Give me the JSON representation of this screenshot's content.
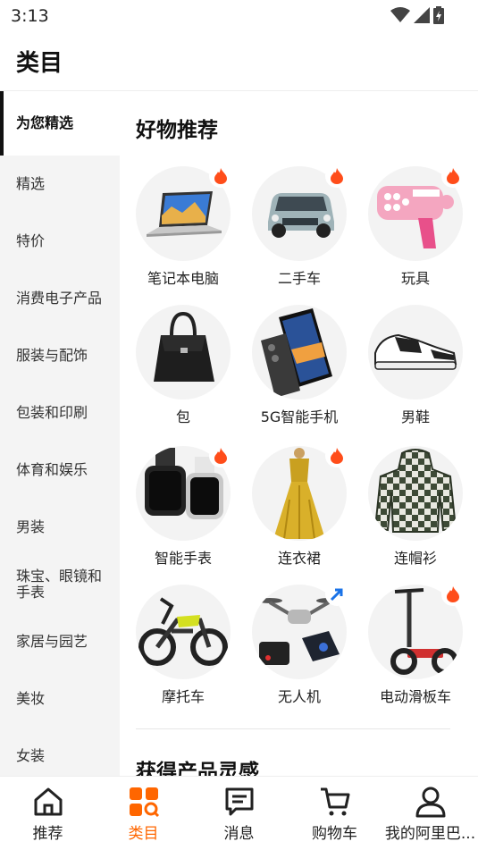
{
  "status": {
    "time": "3:13"
  },
  "header": {
    "title": "类目"
  },
  "sidebar": {
    "items": [
      {
        "label": "为您精选"
      },
      {
        "label": "精选"
      },
      {
        "label": "特价"
      },
      {
        "label": "消费电子产品"
      },
      {
        "label": "服装与配饰"
      },
      {
        "label": "包装和印刷"
      },
      {
        "label": "体育和娱乐"
      },
      {
        "label": "男装"
      },
      {
        "label": "珠宝、眼镜和手表"
      },
      {
        "label": "家居与园艺"
      },
      {
        "label": "美妆"
      },
      {
        "label": "女装"
      }
    ]
  },
  "main": {
    "section_title": "好物推荐",
    "next_section_title": "获得产品灵感",
    "items": [
      {
        "label": "笔记本电脑",
        "badge": "fire",
        "icon": "laptop-icon"
      },
      {
        "label": "二手车",
        "badge": "fire",
        "icon": "car-icon"
      },
      {
        "label": "玩具",
        "badge": "fire",
        "icon": "bubble-gun-icon"
      },
      {
        "label": "包",
        "badge": "",
        "icon": "handbag-icon"
      },
      {
        "label": "5G智能手机",
        "badge": "",
        "icon": "smartphone-icon"
      },
      {
        "label": "男鞋",
        "badge": "",
        "icon": "sneaker-icon"
      },
      {
        "label": "智能手表",
        "badge": "fire",
        "icon": "smartwatch-icon"
      },
      {
        "label": "连衣裙",
        "badge": "fire",
        "icon": "dress-icon"
      },
      {
        "label": "连帽衫",
        "badge": "",
        "icon": "hoodie-icon"
      },
      {
        "label": "摩托车",
        "badge": "",
        "icon": "motorcycle-icon"
      },
      {
        "label": "无人机",
        "badge": "trend",
        "icon": "drone-icon"
      },
      {
        "label": "电动滑板车",
        "badge": "fire",
        "icon": "scooter-icon"
      }
    ]
  },
  "nav": {
    "items": [
      {
        "label": "推荐",
        "icon": "home-icon"
      },
      {
        "label": "类目",
        "icon": "category-icon"
      },
      {
        "label": "消息",
        "icon": "message-icon"
      },
      {
        "label": "购物车",
        "icon": "cart-icon"
      },
      {
        "label": "我的阿里巴...",
        "icon": "user-icon"
      }
    ]
  },
  "colors": {
    "accent": "#ff6600",
    "fire": "#ff4d1a",
    "trend": "#1a73e8",
    "sidebar_bg": "#f4f4f4"
  }
}
